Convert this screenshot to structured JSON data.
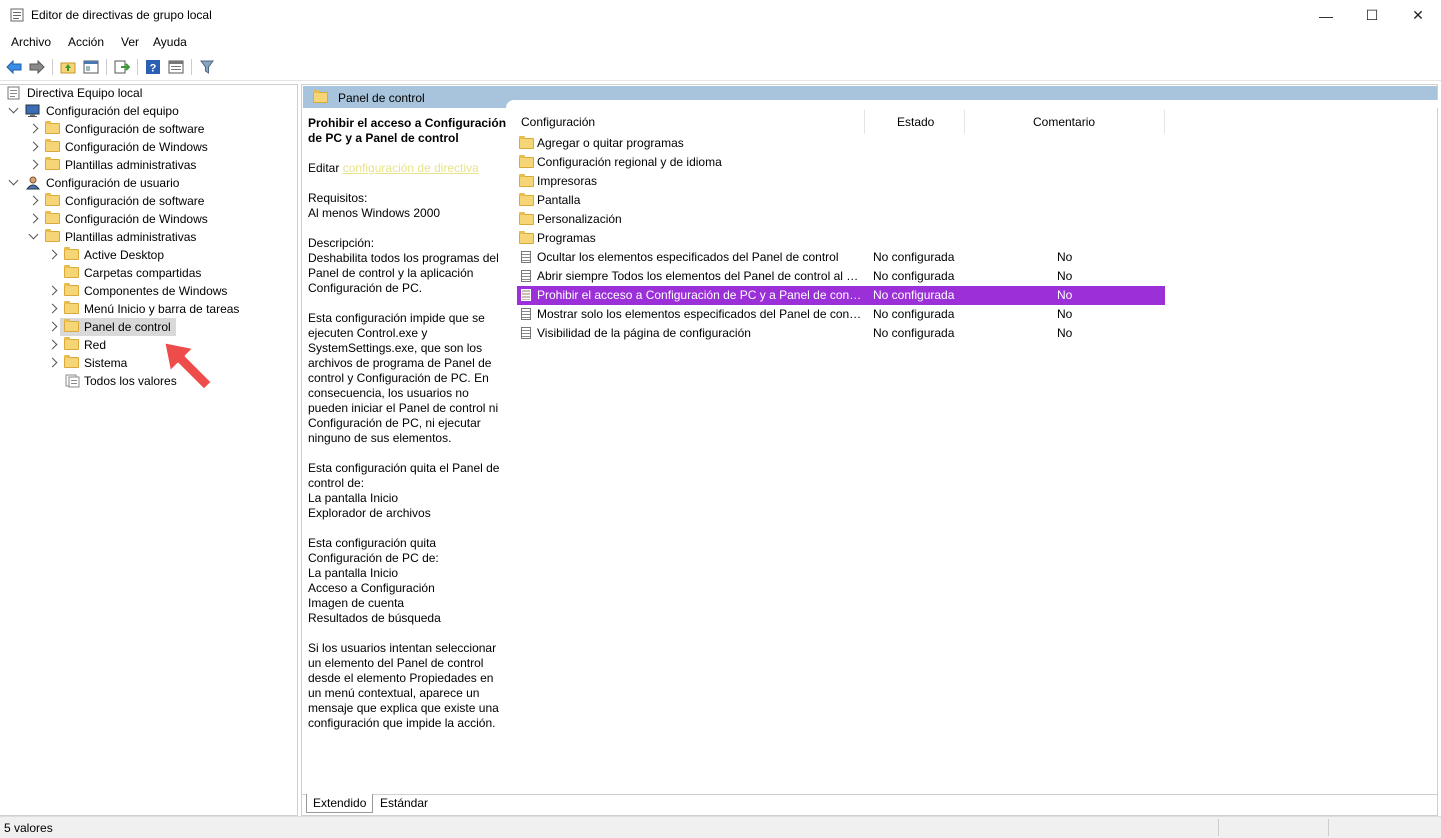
{
  "window": {
    "title": "Editor de directivas de grupo local",
    "min_glyph": "—",
    "max_glyph": "☐",
    "close_glyph": "✕"
  },
  "menu": [
    "Archivo",
    "Acción",
    "Ver",
    "Ayuda"
  ],
  "tree": {
    "root": "Directiva Equipo local",
    "equipo": "Configuración del equipo",
    "equipo_software": "Configuración de software",
    "equipo_windows": "Configuración de Windows",
    "equipo_plantillas": "Plantillas administrativas",
    "usuario": "Configuración de usuario",
    "usuario_software": "Configuración de software",
    "usuario_windows": "Configuración de Windows",
    "usuario_plantillas": "Plantillas administrativas",
    "active_desktop": "Active Desktop",
    "carpetas": "Carpetas compartidas",
    "componentes": "Componentes de Windows",
    "menu_inicio": "Menú Inicio y barra de tareas",
    "panel_control": "Panel de control",
    "red": "Red",
    "sistema": "Sistema",
    "todos": "Todos los valores"
  },
  "pane": {
    "header": "Panel de control",
    "desc_title": "Prohibir el acceso a Configuración de PC y a Panel de control",
    "edit_prefix": "Editar",
    "edit_link": "configuración de directiva",
    "req_label": "Requisitos:",
    "req_value": "Al menos Windows 2000",
    "desc_label": "Descripción:",
    "desc_1": "Deshabilita todos los programas del Panel de control y la aplicación Configuración de PC.",
    "desc_2": "Esta configuración impide que se ejecuten Control.exe y SystemSettings.exe, que son los archivos de programa de Panel de control y Configuración de PC. En consecuencia, los usuarios no pueden iniciar el Panel de control ni Configuración de PC, ni ejecutar ninguno de sus elementos.",
    "desc_3a": "Esta configuración quita el Panel de control de:",
    "desc_3b": "La pantalla Inicio",
    "desc_3c": "Explorador de archivos",
    "desc_4a": "Esta configuración quita Configuración de PC de:",
    "desc_4b": "La pantalla Inicio",
    "desc_4c": "Acceso a Configuración",
    "desc_4d": "Imagen de cuenta",
    "desc_4e": "Resultados de búsqueda",
    "desc_5": "Si los usuarios intentan seleccionar un elemento del Panel de control desde el elemento Propiedades en un menú contextual, aparece un mensaje que explica que existe una configuración que impide la acción."
  },
  "list": {
    "columns": [
      "Configuración",
      "Estado",
      "Comentario"
    ],
    "folders": [
      "Agregar o quitar programas",
      "Configuración regional y de idioma",
      "Impresoras",
      "Pantalla",
      "Personalización",
      "Programas"
    ],
    "settings": [
      {
        "name": "Ocultar los elementos especificados del Panel de control",
        "estado": "No configurada",
        "comentario": "No"
      },
      {
        "name": "Abrir siempre Todos los elementos del Panel de control al ab...",
        "estado": "No configurada",
        "comentario": "No"
      },
      {
        "name": "Prohibir el acceso a Configuración de PC y a Panel de control",
        "estado": "No configurada",
        "comentario": "No"
      },
      {
        "name": "Mostrar solo los elementos especificados del Panel de control",
        "estado": "No configurada",
        "comentario": "No"
      },
      {
        "name": "Visibilidad de la página de configuración",
        "estado": "No configurada",
        "comentario": "No"
      }
    ],
    "selected_color": "#9b30d9"
  },
  "tabs": [
    "Extendido",
    "Estándar"
  ],
  "status": "5 valores"
}
